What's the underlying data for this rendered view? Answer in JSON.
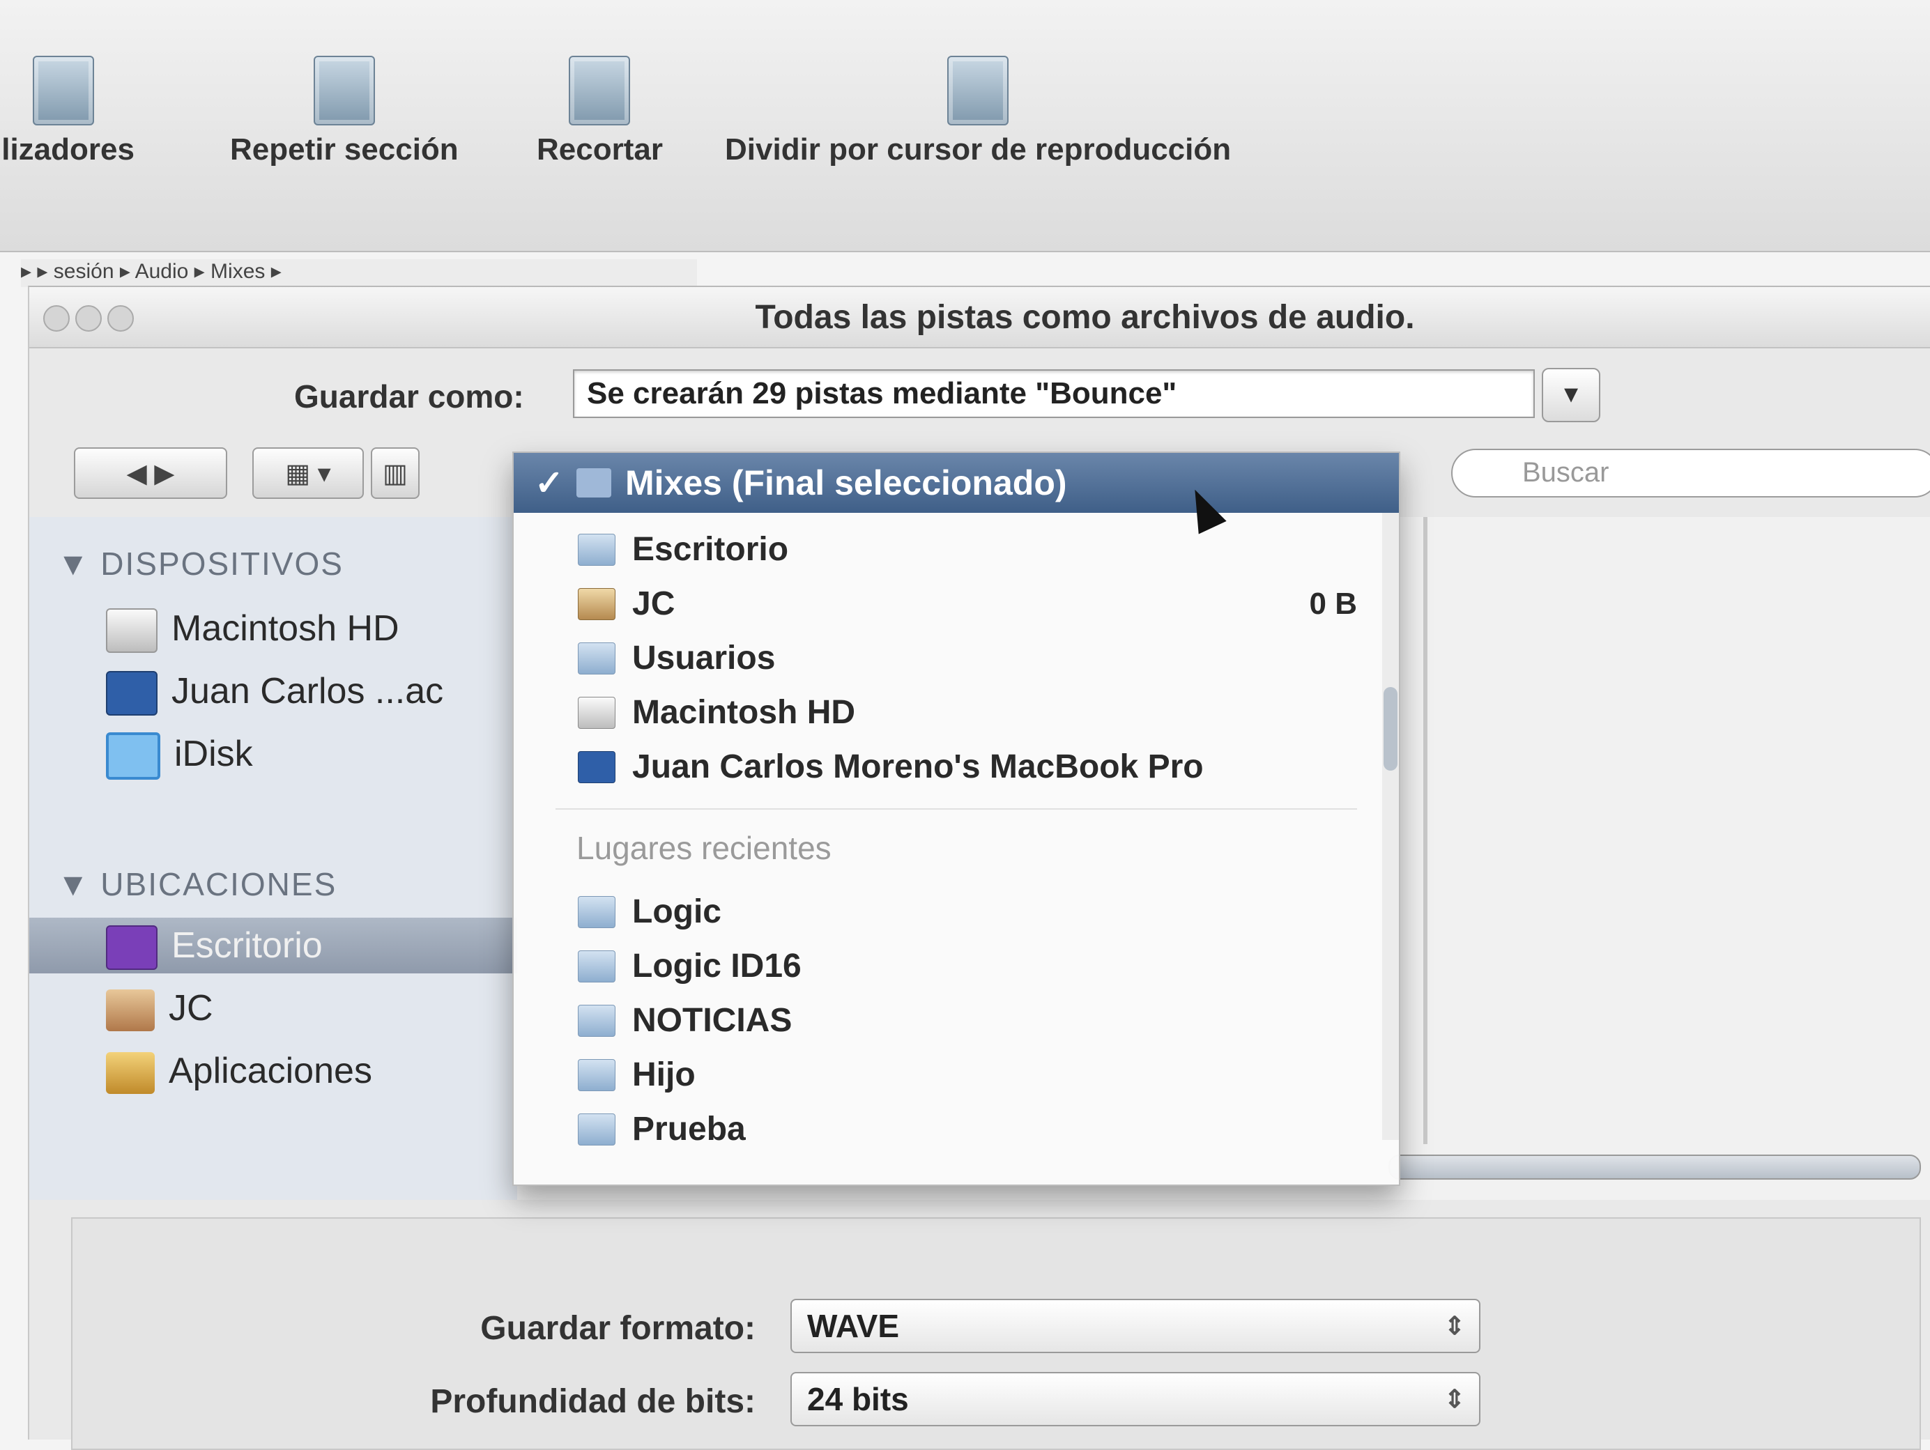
{
  "toolbar": {
    "tools": [
      {
        "label": "ilizadores",
        "icon": "locators-icon"
      },
      {
        "label": "Repetir sección",
        "icon": "repeat-section-icon"
      },
      {
        "label": "Recortar",
        "icon": "trim-icon"
      },
      {
        "label": "Dividir por cursor de reproducción",
        "icon": "split-playhead-icon"
      }
    ],
    "path_strip": "▸  ▸  sesión  ▸  Audio  ▸  Mixes  ▸"
  },
  "sheet": {
    "title": "Todas las pistas como archivos de audio.",
    "save_as_label": "Guardar como:",
    "save_as_value": "Se crearán 29 pistas mediante \"Bounce\"",
    "expand_label": "▾"
  },
  "nav": {
    "back_forward": "◀  ▶",
    "view_mode": "▦ ▾",
    "column_view": "▥",
    "search_placeholder": "Buscar"
  },
  "sidebar": {
    "devices_header": "▼ DISPOSITIVOS",
    "devices": [
      {
        "label": "Macintosh HD",
        "icon": "hard-drive-icon"
      },
      {
        "label": "Juan Carlos ...ac",
        "icon": "laptop-icon"
      },
      {
        "label": "iDisk",
        "icon": "idisk-icon"
      }
    ],
    "places_header": "▼ UBICACIONES",
    "places": [
      {
        "label": "Escritorio",
        "icon": "desktop-icon",
        "selected": true
      },
      {
        "label": "JC",
        "icon": "home-icon"
      },
      {
        "label": "Aplicaciones",
        "icon": "applications-icon"
      }
    ]
  },
  "popup": {
    "selected": "Mixes (Final seleccionado)",
    "items": [
      {
        "label": "Escritorio",
        "icon": "folder-icon"
      },
      {
        "label": "JC",
        "icon": "home-icon",
        "extra": "0 B"
      },
      {
        "label": "Usuarios",
        "icon": "folder-icon"
      },
      {
        "label": "Macintosh HD",
        "icon": "hard-drive-icon"
      },
      {
        "label": "Juan Carlos Moreno's MacBook Pro",
        "icon": "laptop-icon"
      }
    ],
    "recent_header": "Lugares recientes",
    "recent": [
      {
        "label": "Logic",
        "icon": "folder-icon"
      },
      {
        "label": "Logic ID16",
        "icon": "folder-icon"
      },
      {
        "label": "NOTICIAS",
        "icon": "folder-icon"
      },
      {
        "label": "Hijo",
        "icon": "folder-icon"
      },
      {
        "label": "Prueba",
        "icon": "folder-icon"
      }
    ]
  },
  "options": {
    "format_label": "Guardar formato:",
    "format_value": "WAVE",
    "bitdepth_label": "Profundidad de bits:",
    "bitdepth_value": "24 bits",
    "select_arrows": "⇕"
  },
  "colors": {
    "menu_highlight": "#4a6a94",
    "sidebar_bg": "#e2e7ee"
  }
}
